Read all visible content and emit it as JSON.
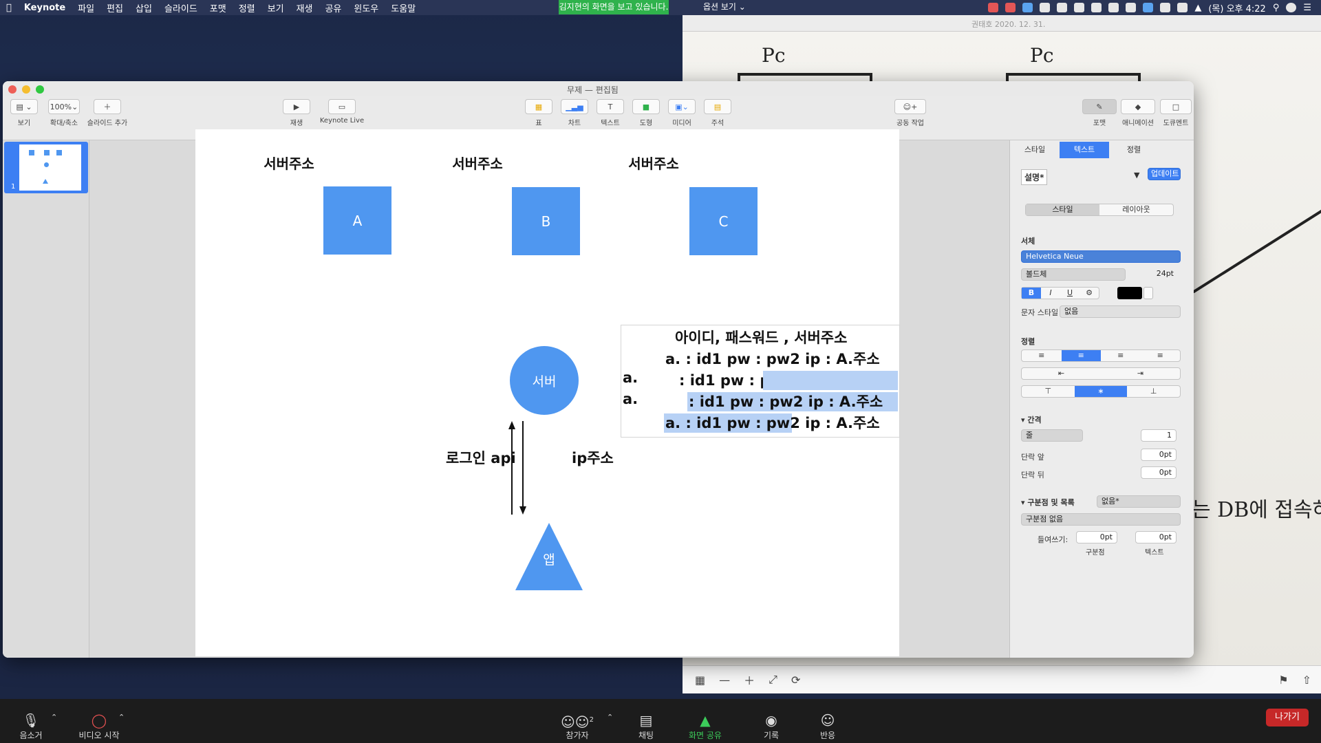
{
  "menubar": {
    "app_name": "Keynote",
    "items": [
      "파일",
      "편집",
      "삽입",
      "슬라이드",
      "포맷",
      "정렬",
      "보기",
      "재생",
      "공유",
      "윈도우",
      "도움말"
    ],
    "share_banner": "김지현의 화면을 보고 있습니다.",
    "view_options": "옵션 보기 ⌄",
    "clock": "(목) 오후 4:22"
  },
  "photo_window": {
    "caption": "권태호 2020. 12. 31.",
    "sketch_labels": [
      "Pc",
      "Pc"
    ],
    "sketch_text": "는 DB에 접속하"
  },
  "keynote": {
    "title": "무제 — 편집됨",
    "toolbar": {
      "view": "보기",
      "zoom_value": "100%",
      "zoom_label": "확대/축소",
      "add_slide": "슬라이드 추가",
      "play": "재생",
      "keynote_live": "Keynote Live",
      "table": "표",
      "chart": "차트",
      "text": "텍스트",
      "shape": "도형",
      "media": "미디어",
      "comment": "주석",
      "collaborate": "공동 작업",
      "format": "포맷",
      "animate": "애니메이션",
      "document": "도큐멘트"
    },
    "slide_number": "1"
  },
  "slide": {
    "headers": [
      "서버주소",
      "서버주소",
      "서버주소"
    ],
    "boxes": [
      "A",
      "B",
      "C"
    ],
    "server_label": "서버",
    "app_label": "앱",
    "login_label": "로그인 api",
    "ip_label": "ip주소",
    "textbox": {
      "line1": "아이디, 패스워드 , 서버주소",
      "line2": "a. : id1 pw : pw2 ip : A.주소",
      "line3_prefix": "a.",
      "line3": ": id1 pw : pw2 ip : A.주소",
      "line4_prefix": "a.",
      "line4": ": id1 pw : pw2 ip : A.주소",
      "line5": "a. : id1 pw : pw2 ip : A.주소"
    }
  },
  "inspector": {
    "tabs": [
      "스타일",
      "텍스트",
      "정렬"
    ],
    "paragraph_style": "설명*",
    "update": "업데이트",
    "subtabs": [
      "스타일",
      "레이아웃"
    ],
    "font_section": "서체",
    "font_family": "Helvetica Neue",
    "font_weight": "볼드체",
    "font_size": "24pt",
    "char_style_label": "문자 스타일",
    "char_style_value": "없음",
    "align_section": "정렬",
    "spacing_section": "간격",
    "spacing_type": "줄",
    "spacing_value": "1",
    "before_label": "단락 앞",
    "before_value": "0pt",
    "after_label": "단락 뒤",
    "after_value": "0pt",
    "bullets_section": "구분점 및 목록",
    "bullets_value": "없음*",
    "bullet_type": "구분점 없음",
    "indent_label": "들여쓰기:",
    "indent_bullet": "0pt",
    "indent_text": "0pt",
    "indent_bullet_label": "구분점",
    "indent_text_label": "텍스트"
  },
  "zoom": {
    "mute": "음소거",
    "video": "비디오 시작",
    "participants": "참가자",
    "participants_count": "2",
    "chat": "채팅",
    "share": "화면 공유",
    "record": "기록",
    "reactions": "반응",
    "leave": "나가기"
  }
}
